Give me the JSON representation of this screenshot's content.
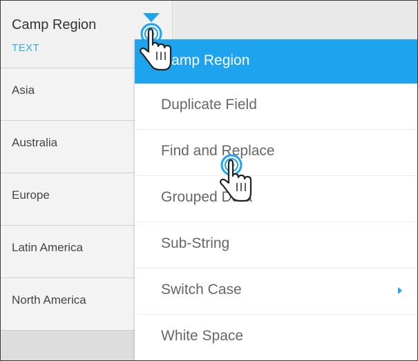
{
  "column": {
    "title": "Camp Region",
    "type": "TEXT"
  },
  "rows": [
    "Asia",
    "Australia",
    "Europe",
    "Latin America",
    "North America"
  ],
  "menu": {
    "items": [
      {
        "label": "Camp Region"
      },
      {
        "label": "Duplicate Field"
      },
      {
        "label": "Find and Replace"
      },
      {
        "label": "Grouped Data"
      },
      {
        "label": "Sub-String"
      },
      {
        "label": "Switch Case"
      },
      {
        "label": "White Space"
      }
    ]
  },
  "colors": {
    "accent": "#1ea3ef",
    "type_label": "#35a8e6"
  },
  "icons": {
    "dropdown": "caret-down-icon",
    "cursor": "hand-pointer-icon",
    "submenu": "chevron-right-icon"
  }
}
